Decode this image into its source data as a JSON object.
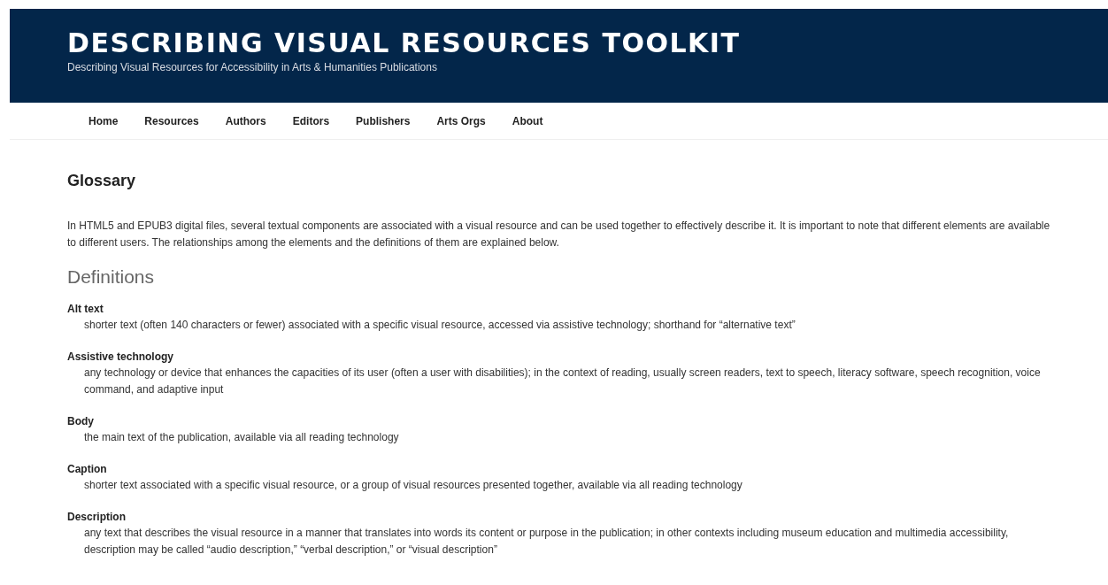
{
  "site_header": {
    "title": "DESCRIBING VISUAL RESOURCES TOOLKIT",
    "tagline": "Describing Visual Resources for Accessibility in Arts & Humanities Publications"
  },
  "nav": [
    "Home",
    "Resources",
    "Authors",
    "Editors",
    "Publishers",
    "Arts Orgs",
    "About"
  ],
  "page": {
    "title": "Glossary",
    "intro": "In HTML5 and EPUB3 digital files, several textual components are associated with a visual resource and can be used together to effectively describe it. It is important to note that different elements are available to different users. The relationships among the elements and the definitions of them are explained below.",
    "section_heading": "Definitions",
    "definitions": [
      {
        "term": "Alt text",
        "definition": "shorter text (often 140 characters or fewer) associated with a specific visual resource, accessed via assistive technology; shorthand for “alternative text”"
      },
      {
        "term": "Assistive technology",
        "definition": "any technology or device that enhances the capacities of its user (often a user with disabilities); in the context of reading, usually screen readers,  text to speech, literacy software, speech recognition, voice command, and adaptive input"
      },
      {
        "term": "Body",
        "definition": "the main text of the publication, available via all reading technology"
      },
      {
        "term": "Caption",
        "definition": "shorter text associated with a specific visual resource, or a group of visual resources presented together, available via all reading technology"
      },
      {
        "term": "Description",
        "definition": "any text that describes the visual resource in a manner that translates into words its content or purpose in the publication; in other contexts including museum education and multimedia accessibility, description may be called “audio description,” “verbal description,” or “visual description”"
      }
    ]
  }
}
